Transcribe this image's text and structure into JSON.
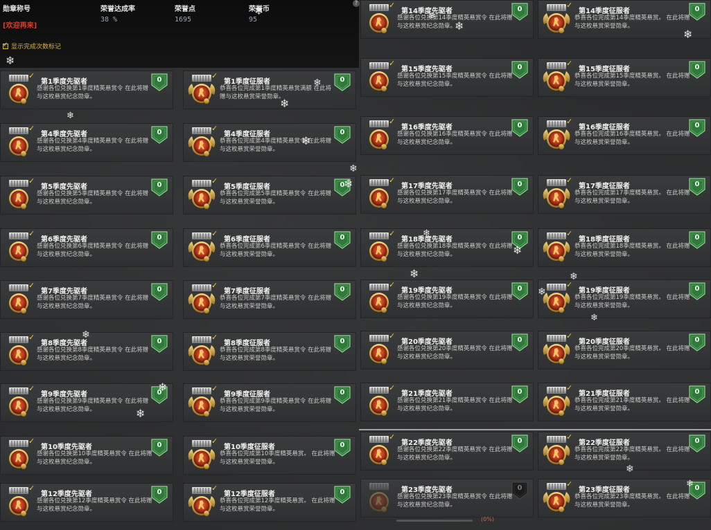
{
  "header": {
    "col1": {
      "label": "勋章称号"
    },
    "col2": {
      "label": "荣誉达成率",
      "value": "38 %"
    },
    "col3": {
      "label": "荣誉点",
      "value": "1695"
    },
    "col4": {
      "label": "荣誉币",
      "value": "95"
    },
    "title_value": "[欢迎再来]",
    "show_completed_label": "显示完成次数标记",
    "help": "?"
  },
  "colors": {
    "accent_gold": "#f0c43a",
    "shield_green": "#2f7a3a",
    "title_red": "#e03a2a"
  },
  "tiles": [
    {
      "name": "第1季度先驱者",
      "desc": "感谢各位兑换第1季度精英悬赏令 在此将赠与这枚悬赏纪念勋章。",
      "type": "pioneer",
      "count": "0"
    },
    {
      "name": "第1季度征服者",
      "desc": "恭喜各位完成第1季度精英悬赏满额 在此将赠与这枚悬赏荣誉勋章。",
      "type": "conqueror",
      "count": "0"
    },
    {
      "name": "第4季度先驱者",
      "desc": "感谢各位兑换第4季度精英悬赏令 在此将赠与这枚悬赏纪念勋章。",
      "type": "pioneer",
      "count": "0"
    },
    {
      "name": "第4季度征服者",
      "desc": "恭喜各位完成第4季度精英悬赏令 在此将赠与这枚悬赏荣誉勋章。",
      "type": "conqueror",
      "count": "0"
    },
    {
      "name": "第5季度先驱者",
      "desc": "感谢各位兑换第5季度精英悬赏令 在此将赠与这枚悬赏纪念勋章。",
      "type": "pioneer",
      "count": "0"
    },
    {
      "name": "第5季度征服者",
      "desc": "恭喜各位完成第5季度精英悬赏令 在此将赠与这枚悬赏荣誉勋章。",
      "type": "conqueror",
      "count": "0"
    },
    {
      "name": "第6季度先驱者",
      "desc": "感谢各位兑换第6季度精英悬赏令 在此将赠与这枚悬赏纪念勋章。",
      "type": "pioneer",
      "count": "0"
    },
    {
      "name": "第6季度征服者",
      "desc": "恭喜各位完成第6季度精英悬赏令 在此将赠与这枚悬赏荣誉勋章。",
      "type": "conqueror",
      "count": "0"
    },
    {
      "name": "第7季度先驱者",
      "desc": "感谢各位兑换第7季度精英悬赏令 在此将赠与这枚悬赏纪念勋章。",
      "type": "pioneer",
      "count": "0"
    },
    {
      "name": "第7季度征服者",
      "desc": "恭喜各位完成第7季度精英悬赏令 在此将赠与这枚悬赏荣誉勋章。",
      "type": "conqueror",
      "count": "0"
    },
    {
      "name": "第8季度先驱者",
      "desc": "感谢各位兑换第8季度精英悬赏令 在此将赠与这枚悬赏纪念勋章。",
      "type": "pioneer",
      "count": "0"
    },
    {
      "name": "第8季度征服者",
      "desc": "恭喜各位完成第8季度精英悬赏令 在此将赠与这枚悬赏荣誉勋章。",
      "type": "conqueror",
      "count": "0"
    },
    {
      "name": "第9季度先驱者",
      "desc": "感谢各位兑换第9季度精英悬赏令 在此将赠与这枚悬赏纪念勋章。",
      "type": "pioneer",
      "count": "0"
    },
    {
      "name": "第9季度征服者",
      "desc": "恭喜各位完成第9季度精英悬赏令 在此将赠与这枚悬赏荣誉勋章。",
      "type": "conqueror",
      "count": "0"
    },
    {
      "name": "第10季度先驱者",
      "desc": "感谢各位兑换第10季度精英悬赏令 在此将赠与这枚悬赏纪念勋章。",
      "type": "pioneer",
      "count": "0"
    },
    {
      "name": "第10季度征服者",
      "desc": "恭喜各位完成第10季度精英悬赏。 在此将赠与这枚悬赏荣誉勋章。",
      "type": "conqueror",
      "count": "0"
    },
    {
      "name": "第12季度先驱者",
      "desc": "感谢各位兑换第12季度精英悬赏令 在此将赠与这枚悬赏纪念勋章。",
      "type": "pioneer",
      "count": "0"
    },
    {
      "name": "第12季度征服者",
      "desc": "恭喜各位完成第12季度精英悬赏。 在此将赠与这枚悬赏荣誉勋章。",
      "type": "conqueror",
      "count": "0"
    },
    {
      "name": "第14季度先驱者",
      "desc": "感谢各位兑换第14季度精英悬赏令 在此将赠与这枚悬赏纪念勋章。",
      "type": "pioneer",
      "count": "0"
    },
    {
      "name": "第14季度征服者",
      "desc": "恭喜各位完成第14季度精英悬赏。 在此将赠与这枚悬赏荣誉勋章。",
      "type": "conqueror",
      "count": "0"
    },
    {
      "name": "第15季度先驱者",
      "desc": "感谢各位兑换第15季度精英悬赏令 在此将赠与这枚悬赏纪念勋章。",
      "type": "pioneer",
      "count": "0"
    },
    {
      "name": "第15季度征服者",
      "desc": "恭喜各位完成第15季度精英悬赏。 在此将赠与这枚悬赏荣誉勋章。",
      "type": "conqueror",
      "count": "0"
    },
    {
      "name": "第16季度先驱者",
      "desc": "感谢各位兑换第16季度精英悬赏令 在此将赠与这枚悬赏纪念勋章。",
      "type": "pioneer",
      "count": "0"
    },
    {
      "name": "第16季度征服者",
      "desc": "恭喜各位完成第16季度精英悬赏。 在此将赠与这枚悬赏荣誉勋章。",
      "type": "conqueror",
      "count": "0"
    },
    {
      "name": "第17季度先驱者",
      "desc": "感谢各位兑换第17季度精英悬赏令 在此将赠与这枚悬赏纪念勋章。",
      "type": "pioneer",
      "count": "0"
    },
    {
      "name": "第17季度征服者",
      "desc": "恭喜各位完成第17季度精英悬赏。 在此将赠与这枚悬赏荣誉勋章。",
      "type": "conqueror",
      "count": "0"
    },
    {
      "name": "第18季度先驱者",
      "desc": "感谢各位兑换第18季度精英悬赏令 在此将赠与这枚悬赏纪念勋章。",
      "type": "pioneer",
      "count": "0"
    },
    {
      "name": "第18季度征服者",
      "desc": "恭喜各位完成第18季度精英悬赏。 在此将赠与这枚悬赏荣誉勋章。",
      "type": "conqueror",
      "count": "0"
    },
    {
      "name": "第19季度先驱者",
      "desc": "感谢各位兑换第19季度精英悬赏令 在此将赠与这枚悬赏纪念勋章。",
      "type": "pioneer",
      "count": "0"
    },
    {
      "name": "第19季度征服者",
      "desc": "恭喜各位完成第19季度精英悬赏。 在此将赠与这枚悬赏荣誉勋章。",
      "type": "conqueror",
      "count": "0"
    },
    {
      "name": "第20季度先驱者",
      "desc": "感谢各位兑换第20季度精英悬赏令 在此将赠与这枚悬赏纪念勋章。",
      "type": "pioneer",
      "count": "0"
    },
    {
      "name": "第20季度征服者",
      "desc": "恭喜各位完成第20季度精英悬赏。 在此将赠与这枚悬赏荣誉勋章。",
      "type": "conqueror",
      "count": "0"
    },
    {
      "name": "第21季度先驱者",
      "desc": "感谢各位兑换第21季度精英悬赏令 在此将赠与这枚悬赏纪念勋章。",
      "type": "pioneer",
      "count": "0"
    },
    {
      "name": "第21季度征服者",
      "desc": "恭喜各位完成第21季度精英悬赏。 在此将赠与这枚悬赏荣誉勋章。",
      "type": "conqueror",
      "count": "0"
    },
    {
      "name": "第22季度先驱者",
      "desc": "感谢各位兑换第22季度精英悬赏令 在此将赠与这枚悬赏纪念勋章。",
      "type": "pioneer",
      "count": "0"
    },
    {
      "name": "第22季度征服者",
      "desc": "恭喜各位完成第22季度精英悬赏。 在此将赠与这枚悬赏荣誉勋章。",
      "type": "conqueror",
      "count": "0"
    },
    {
      "name": "第23季度先驱者",
      "desc": "感谢各位兑换第23季度精英悬赏令 在此将赠与这枚悬赏纪念勋章。",
      "type": "pioneer",
      "count": "0",
      "locked": true
    },
    {
      "name": "第23季度征服者",
      "desc": "恭喜各位完成第23季度精英悬赏。 在此将赠与这枚悬赏荣誉勋章。",
      "type": "conqueror",
      "count": "0"
    }
  ],
  "footer": {
    "progress_label": "(0%)"
  }
}
